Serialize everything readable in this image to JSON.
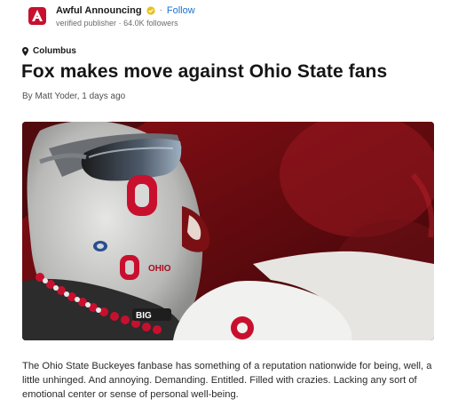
{
  "publisher": {
    "name": "Awful Announcing",
    "follow_label": "Follow",
    "separator": "·",
    "status": "verified publisher",
    "followers": "64.0K followers",
    "logo_icon": "awful-announcing-logo",
    "badge_icon": "verified-badge-icon",
    "brand_color": "#c8102e"
  },
  "article": {
    "location": "Columbus",
    "location_icon": "location-pin-icon",
    "title": "Fox makes move against Ohio State fans",
    "byline": "By Matt Yoder, 1 days ago",
    "hero_image": {
      "description": "Ohio State fan with painted face and sunglasses cheering",
      "visible_text": [
        "O",
        "O",
        "BIG"
      ]
    },
    "body": "The Ohio State Buckeyes fanbase has something of a reputation nationwide for being, well, a little unhinged. And annoying. Demanding. Entitled. Filled with crazies. Lacking any sort of emotional center or sense of personal well-being."
  }
}
